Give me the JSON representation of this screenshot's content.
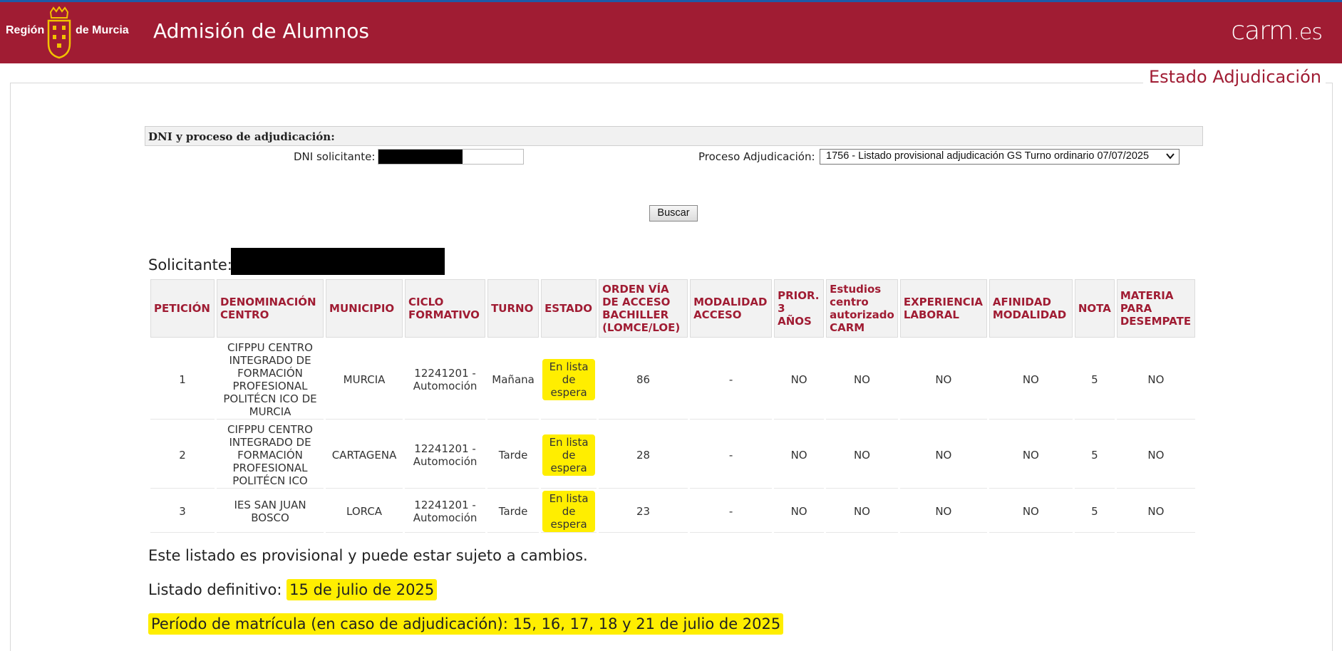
{
  "header": {
    "logo_left": "Región",
    "logo_right": "de Murcia",
    "app_title": "Admisión de Alumnos",
    "brand_main": "carm",
    "brand_suffix": ".es",
    "colors": {
      "brand": "#a01c33",
      "highlight": "#ffee00"
    }
  },
  "section_title": "Estado Adjudicación",
  "form": {
    "title": "DNI y proceso de adjudicación:",
    "dni_label": "DNI solicitante:",
    "dni_value": "",
    "proceso_label": "Proceso Adjudicación:",
    "proceso_selected": "1756 - Listado provisional adjudicación GS Turno ordinario 07/07/2025",
    "search_button": "Buscar"
  },
  "solicitante_label": "Solicitante:",
  "table": {
    "headers": [
      "PETICIÓN",
      "DENOMINACIÓN CENTRO",
      "MUNICIPIO",
      "CICLO FORMATIVO",
      "TURNO",
      "ESTADO",
      "ORDEN VÍA DE ACCESO BACHILLER (LOMCE/LOE)",
      "MODALIDAD ACCESO",
      "PRIOR. 3 AÑOS",
      "Estudios centro autorizado CARM",
      "EXPERIENCIA LABORAL",
      "AFINIDAD MODALIDAD",
      "NOTA",
      "MATERIA PARA DESEMPATE"
    ],
    "rows": [
      [
        "1",
        "CIFPPU CENTRO INTEGRADO DE FORMACIÓN PROFESIONAL POLITÉCN ICO DE MURCIA",
        "MURCIA",
        "12241201 - Automoción",
        "Mañana",
        "En lista de espera",
        "86",
        "-",
        "NO",
        "NO",
        "NO",
        "NO",
        "5",
        "NO"
      ],
      [
        "2",
        "CIFPPU CENTRO INTEGRADO DE FORMACIÓN PROFESIONAL POLITÉCN ICO",
        "CARTAGENA",
        "12241201 - Automoción",
        "Tarde",
        "En lista de espera",
        "28",
        "-",
        "NO",
        "NO",
        "NO",
        "NO",
        "5",
        "NO"
      ],
      [
        "3",
        "IES SAN JUAN BOSCO",
        "LORCA",
        "12241201 - Automoción",
        "Tarde",
        "En lista de espera",
        "23",
        "-",
        "NO",
        "NO",
        "NO",
        "NO",
        "5",
        "NO"
      ]
    ]
  },
  "notes": {
    "provisional": "Este listado es provisional y puede estar sujeto a cambios.",
    "definitivo_label": "Listado definitivo:",
    "definitivo_date": "15 de julio de 2025",
    "matricula": "Período de matrícula (en caso de adjudicación): 15, 16, 17, 18 y 21 de julio de 2025"
  }
}
